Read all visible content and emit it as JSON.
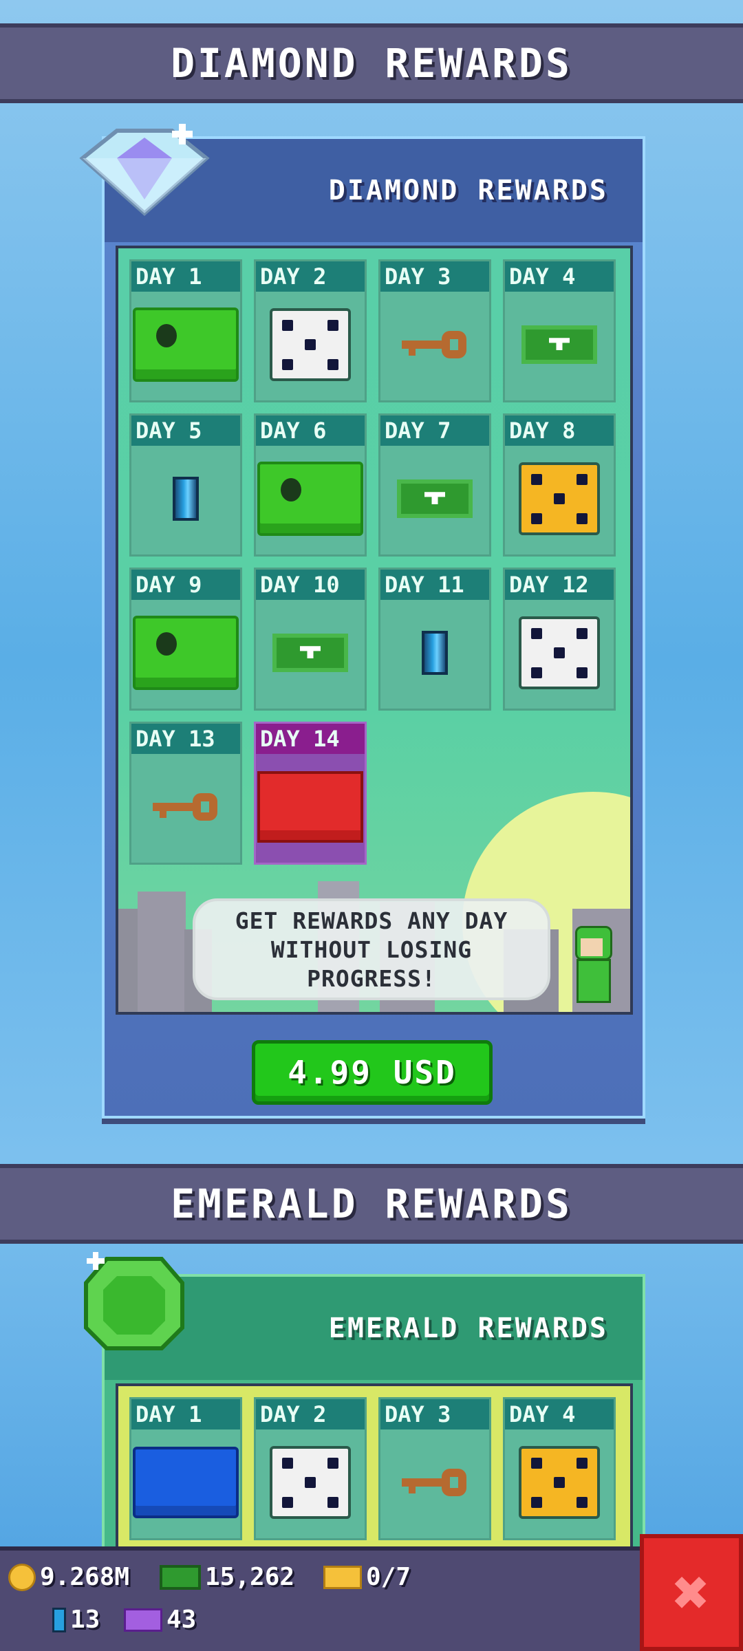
{
  "diamond_section": {
    "banner": "DIAMOND REWARDS",
    "panel_title": "DIAMOND REWARDS",
    "days": [
      {
        "label": "DAY 1",
        "reward": "green-chest-icon"
      },
      {
        "label": "DAY 2",
        "reward": "white-dice-icon"
      },
      {
        "label": "DAY 3",
        "reward": "key-icon"
      },
      {
        "label": "DAY 4",
        "reward": "cash-icon"
      },
      {
        "label": "DAY 5",
        "reward": "gem-icon"
      },
      {
        "label": "DAY 6",
        "reward": "green-chest-icon"
      },
      {
        "label": "DAY 7",
        "reward": "cash-icon"
      },
      {
        "label": "DAY 8",
        "reward": "gold-dice-icon"
      },
      {
        "label": "DAY 9",
        "reward": "green-chest-icon"
      },
      {
        "label": "DAY 10",
        "reward": "cash-icon"
      },
      {
        "label": "DAY 11",
        "reward": "gem-icon"
      },
      {
        "label": "DAY 12",
        "reward": "white-dice-icon"
      },
      {
        "label": "DAY 13",
        "reward": "key-icon"
      },
      {
        "label": "DAY 14",
        "reward": "red-chest-icon"
      }
    ],
    "message": "GET REWARDS ANY DAY WITHOUT LOSING PROGRESS!",
    "price_button": "4.99 USD"
  },
  "emerald_section": {
    "banner": "EMERALD REWARDS",
    "panel_title": "EMERALD REWARDS",
    "days": [
      {
        "label": "DAY 1",
        "reward": "blue-chest-icon"
      },
      {
        "label": "DAY 2",
        "reward": "white-dice-icon"
      },
      {
        "label": "DAY 3",
        "reward": "key-icon"
      },
      {
        "label": "DAY 4",
        "reward": "gold-dice-icon"
      }
    ]
  },
  "currency": {
    "coins": "9.268M",
    "cash": "15,262",
    "tickets": "0/7",
    "gems": "13",
    "premium_tickets": "43"
  },
  "colors": {
    "diamond_panel": "#5a86cf",
    "emerald_panel": "#46b98a",
    "price_button": "#22c71b",
    "close_button": "#e42a2a"
  }
}
